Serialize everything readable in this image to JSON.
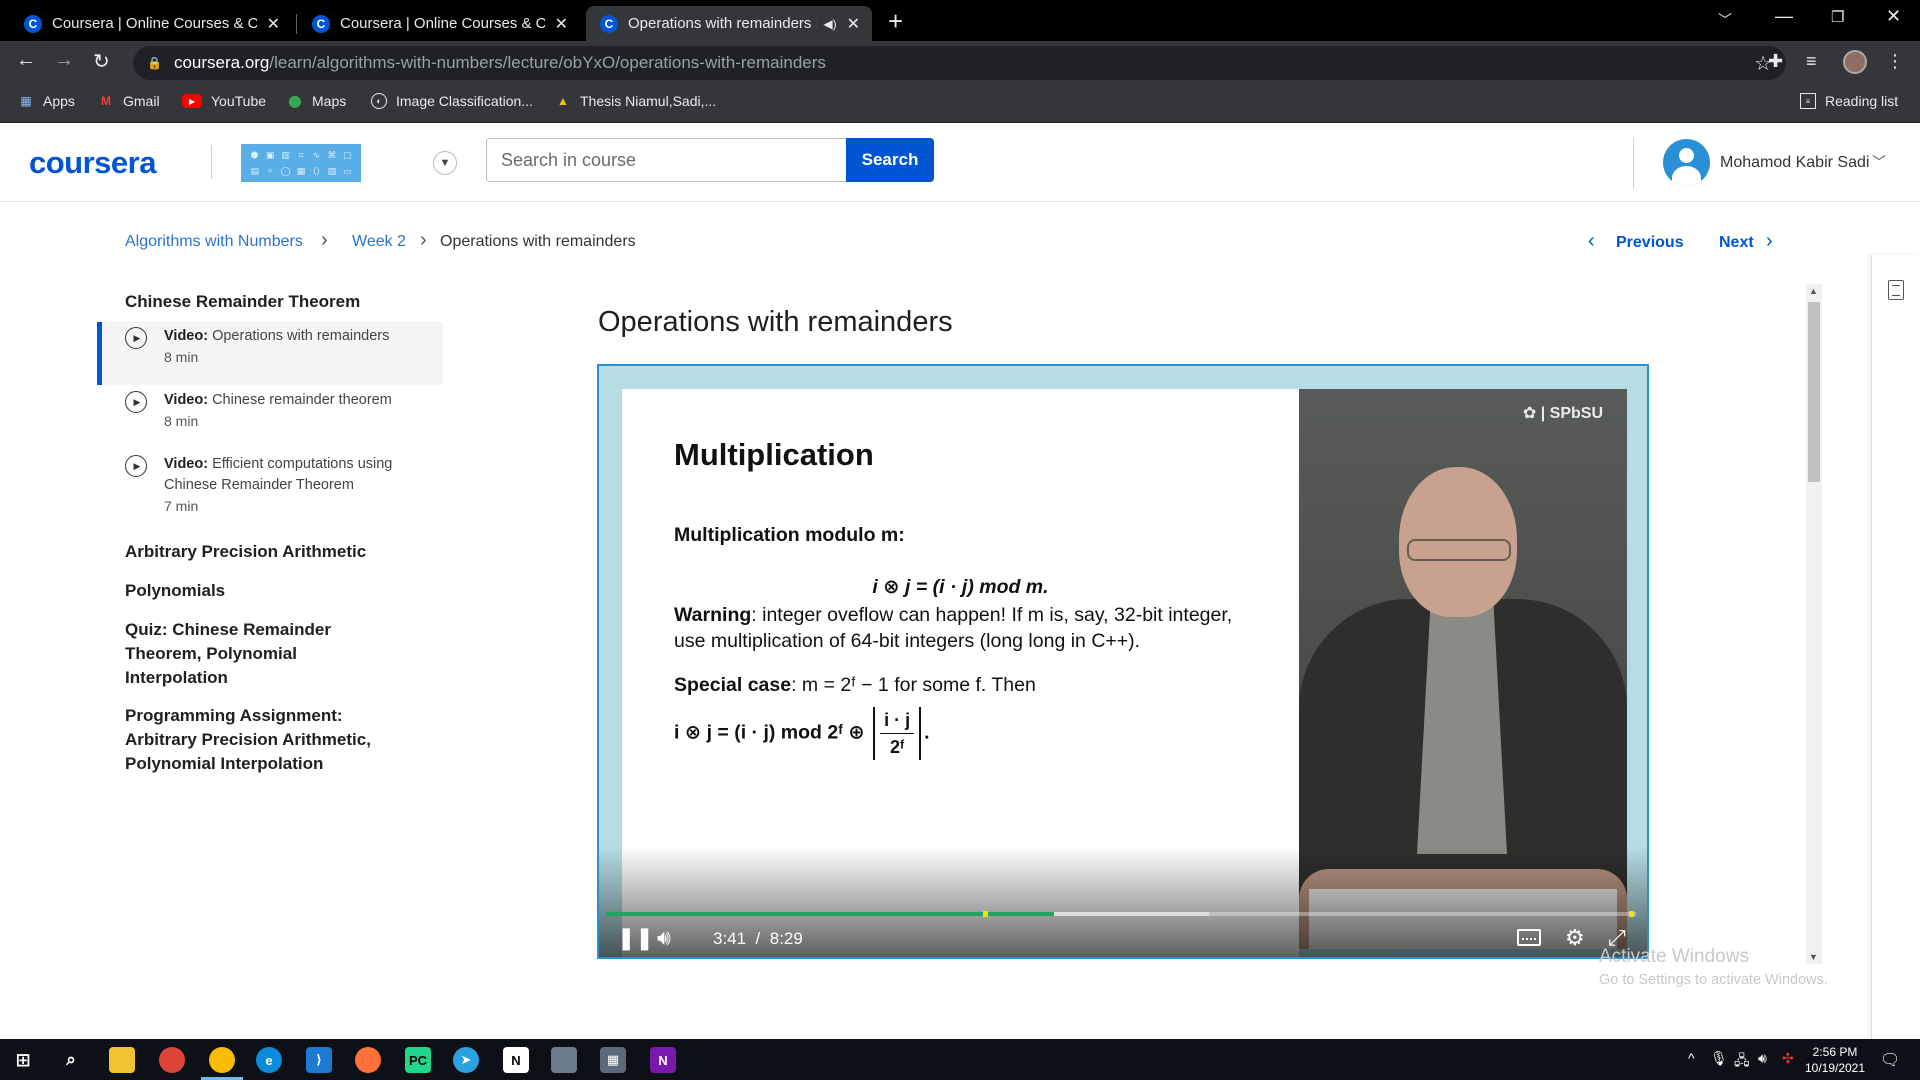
{
  "browser": {
    "tabs": [
      {
        "title": "Coursera | Online Courses & Credentials",
        "active": false
      },
      {
        "title": "Coursera | Online Courses & Credentials",
        "active": false
      },
      {
        "title": "Operations with remainders | Coursera",
        "active": true
      }
    ],
    "url_host": "coursera.org",
    "url_path": "/learn/algorithms-with-numbers/lecture/obYxO/operations-with-remainders",
    "bookmarks": [
      "Apps",
      "Gmail",
      "YouTube",
      "Maps",
      "Image Classification...",
      "Thesis Niamul,Sadi,..."
    ],
    "reading_list": "Reading list"
  },
  "header": {
    "logo": "coursera",
    "search_placeholder": "Search in course",
    "search_button": "Search",
    "user_name": "Mohamod Kabir Sadi"
  },
  "breadcrumb": {
    "course": "Algorithms with Numbers",
    "week": "Week 2",
    "current": "Operations with remainders"
  },
  "pager": {
    "previous": "Previous",
    "next": "Next"
  },
  "sidebar": {
    "section_title": "Chinese Remainder Theorem",
    "items": [
      {
        "type": "Video:",
        "title": "Operations with remainders",
        "duration": "8 min",
        "active": true
      },
      {
        "type": "Video:",
        "title": "Chinese remainder theorem",
        "duration": "8 min",
        "active": false
      },
      {
        "type": "Video:",
        "title": "Efficient computations using Chinese Remainder Theorem",
        "duration": "7 min",
        "active": false
      }
    ],
    "sections": [
      "Arbitrary Precision Arithmetic",
      "Polynomials",
      "Quiz: Chinese Remainder Theorem, Polynomial Interpolation",
      "Programming Assignment: Arbitrary Precision Arithmetic, Polynomial Interpolation"
    ]
  },
  "lecture": {
    "title": "Operations with remainders",
    "slide": {
      "heading": "Multiplication",
      "line1": "Multiplication modulo m:",
      "formula1": "i ⊗ j = (i · j) mod m.",
      "warning_label": "Warning",
      "warning_text": ": integer oveflow can happen! If m is, say, 32-bit integer,",
      "warning_text2": "use multiplication of 64-bit integers (long long in C++).",
      "special_label": "Special case",
      "special_text": ": m = 2ᶠ − 1 for some f. Then",
      "formula2_left": "i ⊗ j = (i · j) mod 2ᶠ ⊕",
      "formula2_num": "i · j",
      "formula2_den": "2ᶠ",
      "watermark": "SPbSU"
    },
    "player": {
      "current_time": "3:41",
      "separator": "/",
      "duration": "8:29",
      "progress_fraction": 0.435,
      "buffered_fraction": 0.585
    }
  },
  "overlay": {
    "activate_title": "Activate Windows",
    "activate_sub": "Go to Settings to activate Windows."
  },
  "taskbar": {
    "time": "2:56 PM",
    "date": "10/19/2021"
  }
}
